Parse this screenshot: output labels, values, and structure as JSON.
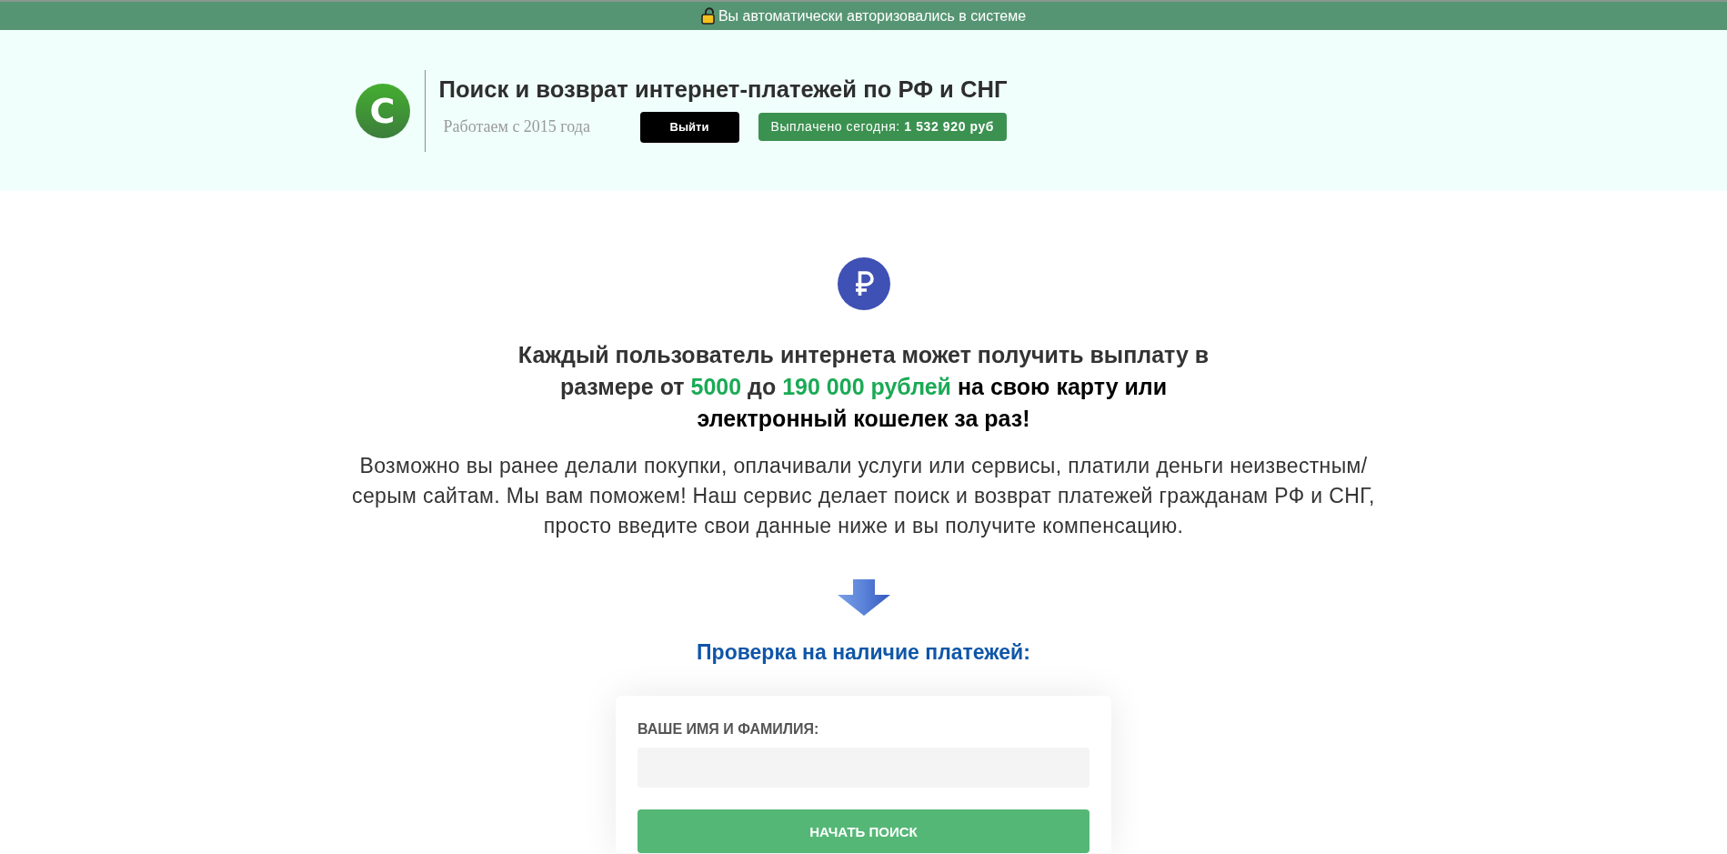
{
  "notice": {
    "text": "Вы автоматически авторизовались в системе"
  },
  "header": {
    "logo_letter": "C",
    "title": "Поиск и возврат интернет-платежей по РФ и СНГ",
    "tagline": "Работаем с 2015 года",
    "logout_button": "Выйти",
    "payout_badge": "Выплачено сегодня: **1 532 920 руб**"
  },
  "offer": {
    "headline": [
      {
        "kind": "plain",
        "text": "Каждый пользователь интернета может получить выплату в размере от "
      },
      {
        "kind": "accent",
        "text": "5000"
      },
      {
        "kind": "plain",
        "text": " до "
      },
      {
        "kind": "accent",
        "text": "190 000 рублей"
      },
      {
        "kind": "strong",
        "text": " на свою карту или электронный кошелек за раз!"
      }
    ],
    "description": "Возможно вы ранее делали покупки, оплачивали услуги или сервисы, платили деньги неизвестным/ серым сайтам. Мы вам поможем! Наш сервис делает поиск и возврат платежей гражданам РФ и СНГ, просто введите свои данные ниже и вы получите компенсацию.",
    "form_heading": "Проверка на наличие платежей:"
  },
  "form": {
    "fields": [
      {
        "label": "ВАШЕ ИМЯ И ФАМИЛИЯ:"
      }
    ],
    "submit_button": "НАЧАТЬ ПОИСК"
  }
}
